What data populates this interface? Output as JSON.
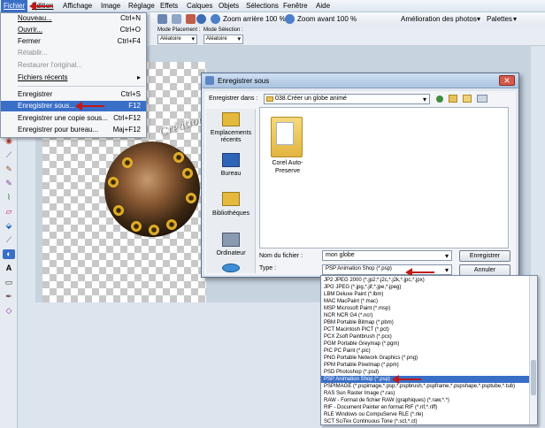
{
  "menubar": {
    "items": [
      "Fichier",
      "Édition",
      "Affichage",
      "Image",
      "Réglage",
      "Effets",
      "Calques",
      "Objets",
      "Sélections",
      "Fenêtre",
      "Aide"
    ]
  },
  "toolbar": {
    "zoom_out": "Zoom arrière 100 %",
    "zoom_in": "Zoom avant 100 %",
    "photo_enhance": "Amélioration des photos",
    "palettes": "Palettes"
  },
  "options_bar": {
    "placement_label": "Mode Placement :",
    "placement_value": "Aléatoire",
    "selection_label": "Mode Sélection :",
    "selection_value": "Aléatoire"
  },
  "file_menu": {
    "items": [
      {
        "label": "Nouveau...",
        "shortcut": "Ctrl+N",
        "disabled": false
      },
      {
        "label": "Ouvrir...",
        "shortcut": "Ctrl+O",
        "disabled": false
      },
      {
        "label": "Fermer",
        "shortcut": "Ctrl+F4",
        "disabled": false
      },
      {
        "label": "Rétablir...",
        "shortcut": "",
        "disabled": true
      },
      {
        "label": "Restaurer l'original...",
        "shortcut": "",
        "disabled": true
      },
      {
        "label": "Fichiers récents",
        "shortcut": "▸",
        "disabled": false
      },
      {
        "label": "Enregistrer",
        "shortcut": "Ctrl+S",
        "disabled": false
      },
      {
        "label": "Enregistrer sous...",
        "shortcut": "F12",
        "disabled": false,
        "highlighted": true
      },
      {
        "label": "Enregistrer une copie sous...",
        "shortcut": "Ctrl+F12",
        "disabled": false
      },
      {
        "label": "Enregistrer pour bureau...",
        "shortcut": "Maj+F12",
        "disabled": false
      }
    ]
  },
  "canvas": {
    "watermark": "Créations Joëlla"
  },
  "dialog": {
    "title": "Enregistrer sous",
    "save_in_label": "Enregistrer dans :",
    "save_in_value": "038.Créer un globe animé",
    "places": [
      "Emplacements récents",
      "Bureau",
      "Bibliothèques",
      "Ordinateur",
      "Réseau"
    ],
    "folder_name": "Corel Auto-Preserve",
    "filename_label": "Nom du fichier :",
    "filename_value": "mon globe",
    "type_label": "Type :",
    "type_value": "PSP Animation Shop (*.psp)",
    "save_button": "Enregistrer",
    "cancel_button": "Annuler"
  },
  "type_list": {
    "selected_index": 11,
    "items": [
      "JP2 JPEG 2000 (*.jp2;*.j2c,*.j2k,*.jpc,*.jpx)",
      "JPG JPEG (*.jpg,*.jif,*.jpe,*.jpeg)",
      "LBM Deluxe Paint (*.lbm)",
      "MAC MacPaint (*.mac)",
      "MSP Microsoft Paint (*.msp)",
      "NCR NCR G4 (*.ncr)",
      "PBM Portable Bitmap (*.pbm)",
      "PCT Macintosh PICT (*.pct)",
      "PCX Zsoft Paintbrush (*.pcx)",
      "PGM Portable Greymap (*.pgm)",
      "PIC PC Paint (*.pic)",
      "PNG Portable Network Graphics (*.png)",
      "PPM Portable Pixelmap (*.ppm)",
      "PSD Photoshop (*.psd)",
      "PSP Animation Shop (*.psp)",
      "PSPIMAGE (*.pspimage,*.psp,*.pspbrush,*.pspframe,*.pspshape,*.psptube,*.tub)",
      "RAS Sun Raster Image (*.ras)",
      "RAW - Format de fichier RAW (graphiques) (*.raw,*.*)",
      "RIF - Document Painter en format RIF (*.rif,*.riff)",
      "RLE Windows ou CompuServe RLE (*.rle)",
      "SCT SciTex Continuous Tone (*.sct,*.ct)"
    ]
  },
  "colors": {
    "highlight": "#3a6fc7",
    "arrow": "#c21818"
  }
}
